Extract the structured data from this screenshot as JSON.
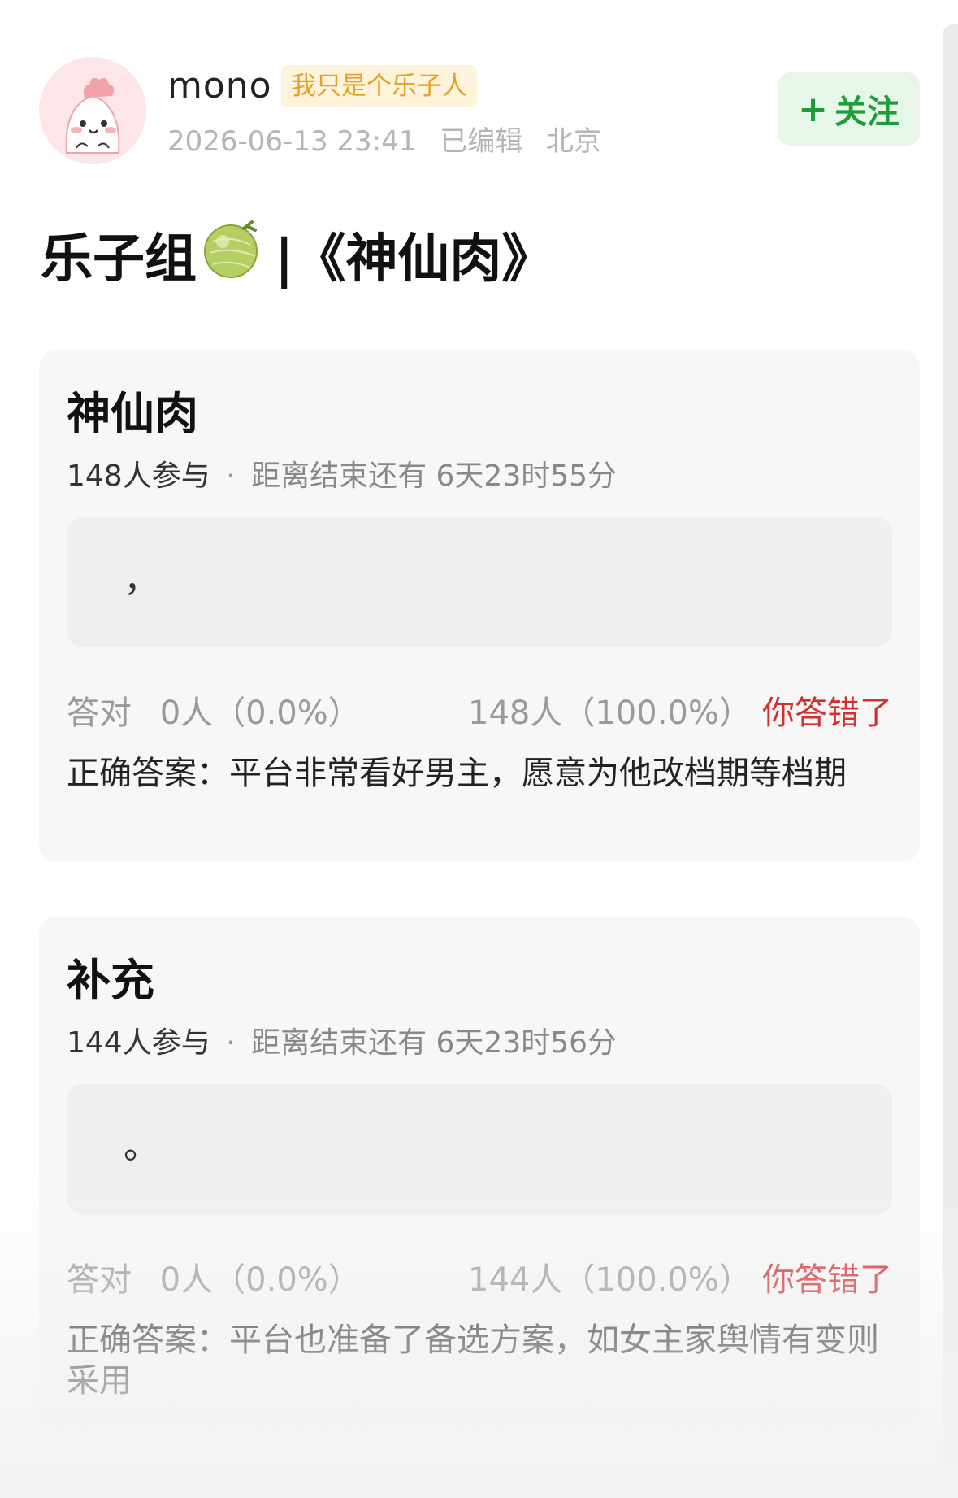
{
  "author": {
    "name": "mono",
    "tag": "我只是个乐子人",
    "datetime": "2026-06-13 23:41",
    "edited": "已编辑",
    "location": "北京"
  },
  "follow": {
    "plus": "+",
    "label": "关注"
  },
  "post": {
    "title_prefix": "乐子组",
    "title_suffix": "|《神仙肉》"
  },
  "polls": [
    {
      "title": "神仙肉",
      "participants": "148人参与",
      "separator": "·",
      "remaining": "距离结束还有 6天23时55分",
      "option_text": "，",
      "correct_label": "答对",
      "correct_stat": "0人（0.0%）",
      "other_stat": "148人（100.0%）",
      "status": "你答错了",
      "answer": "正确答案：平台非常看好男主，愿意为他改档期等档期"
    },
    {
      "title": "补充",
      "participants": "144人参与",
      "separator": "·",
      "remaining": "距离结束还有 6天23时56分",
      "option_text": "。",
      "correct_label": "答对",
      "correct_stat": "0人（0.0%）",
      "other_stat": "144人（100.0%）",
      "status": "你答错了",
      "answer": "正确答案：平台也准备了备选方案，如女主家舆情有变则采用"
    }
  ],
  "colors": {
    "follow_green": "#1f9d3a",
    "tag_orange": "#e4a126",
    "wrong_red": "#d22f2f"
  },
  "icons": [
    "avatar-cartoon",
    "melon-emoji"
  ]
}
